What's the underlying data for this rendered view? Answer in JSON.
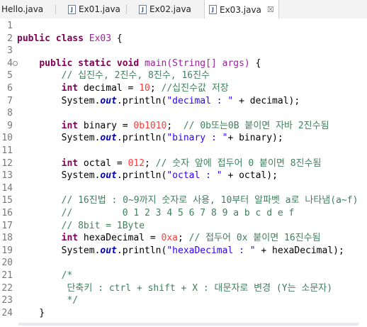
{
  "tabs": [
    {
      "label": "Hello.java",
      "active": false
    },
    {
      "label": "Ex01.java",
      "active": false
    },
    {
      "label": "Ex02.java",
      "active": false
    },
    {
      "label": "Ex03.java",
      "active": true
    }
  ],
  "tab_close_glyph": "☒",
  "file_icon_glyph": "J",
  "colors": {
    "keyword": "#7f0055",
    "comment": "#3f7f5f",
    "string": "#2a00ff",
    "number": "#ff3b3b",
    "field": "#0000c0",
    "line_number": "#787878"
  },
  "editor": {
    "lines": [
      {
        "n": "1",
        "tokens": []
      },
      {
        "n": "2",
        "tokens": [
          [
            "kw",
            "public"
          ],
          [
            "",
            " "
          ],
          [
            "kw",
            "class"
          ],
          [
            "cls",
            " Ex03 "
          ],
          [
            "",
            "{"
          ]
        ]
      },
      {
        "n": "3",
        "tokens": []
      },
      {
        "n": "4",
        "fold": true,
        "tokens": [
          [
            "",
            "    "
          ],
          [
            "kw",
            "public"
          ],
          [
            "",
            " "
          ],
          [
            "kw",
            "static"
          ],
          [
            "",
            " "
          ],
          [
            "kw",
            "void"
          ],
          [
            "cls",
            " main(String[] args) "
          ],
          [
            "",
            "{"
          ]
        ]
      },
      {
        "n": "5",
        "tokens": [
          [
            "",
            "        "
          ],
          [
            "cm",
            "// 십진수, 2진수, 8진수, 16진수"
          ]
        ]
      },
      {
        "n": "6",
        "tokens": [
          [
            "",
            "        "
          ],
          [
            "kw",
            "int"
          ],
          [
            "",
            " decimal = "
          ],
          [
            "num",
            "10"
          ],
          [
            "",
            "; "
          ],
          [
            "cm",
            "//십진수값 저장"
          ]
        ]
      },
      {
        "n": "7",
        "tokens": [
          [
            "",
            "        System."
          ],
          [
            "fld",
            "out"
          ],
          [
            "",
            ".println("
          ],
          [
            "str",
            "\"decimal : \""
          ],
          [
            "",
            " + decimal);"
          ]
        ]
      },
      {
        "n": "8",
        "tokens": []
      },
      {
        "n": "9",
        "tokens": [
          [
            "",
            "        "
          ],
          [
            "kw",
            "int"
          ],
          [
            "",
            " binary = "
          ],
          [
            "num",
            "0b1010"
          ],
          [
            "",
            ";  "
          ],
          [
            "cm",
            "// 0b또는0B 붙이면 자바 2진수됨"
          ]
        ]
      },
      {
        "n": "10",
        "tokens": [
          [
            "",
            "        System."
          ],
          [
            "fld",
            "out"
          ],
          [
            "",
            ".println("
          ],
          [
            "str",
            "\"binary : \""
          ],
          [
            "",
            "+ binary);"
          ]
        ]
      },
      {
        "n": "11",
        "tokens": []
      },
      {
        "n": "12",
        "tokens": [
          [
            "",
            "        "
          ],
          [
            "kw",
            "int"
          ],
          [
            "",
            " octal = "
          ],
          [
            "num",
            "012"
          ],
          [
            "",
            "; "
          ],
          [
            "cm",
            "// 숫자 앞에 접두어 0 붙이면 8진수됨"
          ]
        ]
      },
      {
        "n": "13",
        "tokens": [
          [
            "",
            "        System."
          ],
          [
            "fld",
            "out"
          ],
          [
            "",
            ".println("
          ],
          [
            "str",
            "\"octal : \""
          ],
          [
            "",
            " + octal);"
          ]
        ]
      },
      {
        "n": "14",
        "tokens": []
      },
      {
        "n": "15",
        "tokens": [
          [
            "",
            "        "
          ],
          [
            "cm",
            "// 16진법 : 0~9까지 숫자로 사용, 10부터 알파벳 a로 나타냄(a~f)"
          ]
        ]
      },
      {
        "n": "16",
        "tokens": [
          [
            "",
            "        "
          ],
          [
            "cm",
            "//         0 1 2 3 4 5 6 7 8 9 a b c d e f"
          ]
        ]
      },
      {
        "n": "17",
        "tokens": [
          [
            "",
            "        "
          ],
          [
            "cm",
            "// 8bit = 1Byte"
          ]
        ]
      },
      {
        "n": "18",
        "tokens": [
          [
            "",
            "        "
          ],
          [
            "kw",
            "int"
          ],
          [
            "",
            " hexaDecimal = "
          ],
          [
            "num",
            "0xa"
          ],
          [
            "",
            "; "
          ],
          [
            "cm",
            "// 접두어 0x 붙이면 16진수됨"
          ]
        ]
      },
      {
        "n": "19",
        "tokens": [
          [
            "",
            "        System."
          ],
          [
            "fld",
            "out"
          ],
          [
            "",
            ".println("
          ],
          [
            "str",
            "\"hexaDecimal : \""
          ],
          [
            "",
            " + hexaDecimal);"
          ]
        ]
      },
      {
        "n": "20",
        "tokens": []
      },
      {
        "n": "21",
        "tokens": [
          [
            "",
            "        "
          ],
          [
            "cm",
            "/*"
          ]
        ]
      },
      {
        "n": "22",
        "tokens": [
          [
            "",
            "         "
          ],
          [
            "cm",
            "단축키 : ctrl + shift + X : 대문자로 변경 (Y는 소문자)"
          ]
        ]
      },
      {
        "n": "23",
        "tokens": [
          [
            "",
            "         "
          ],
          [
            "cm",
            "*/"
          ]
        ]
      },
      {
        "n": "24",
        "tokens": [
          [
            "",
            "    }"
          ]
        ]
      }
    ]
  }
}
